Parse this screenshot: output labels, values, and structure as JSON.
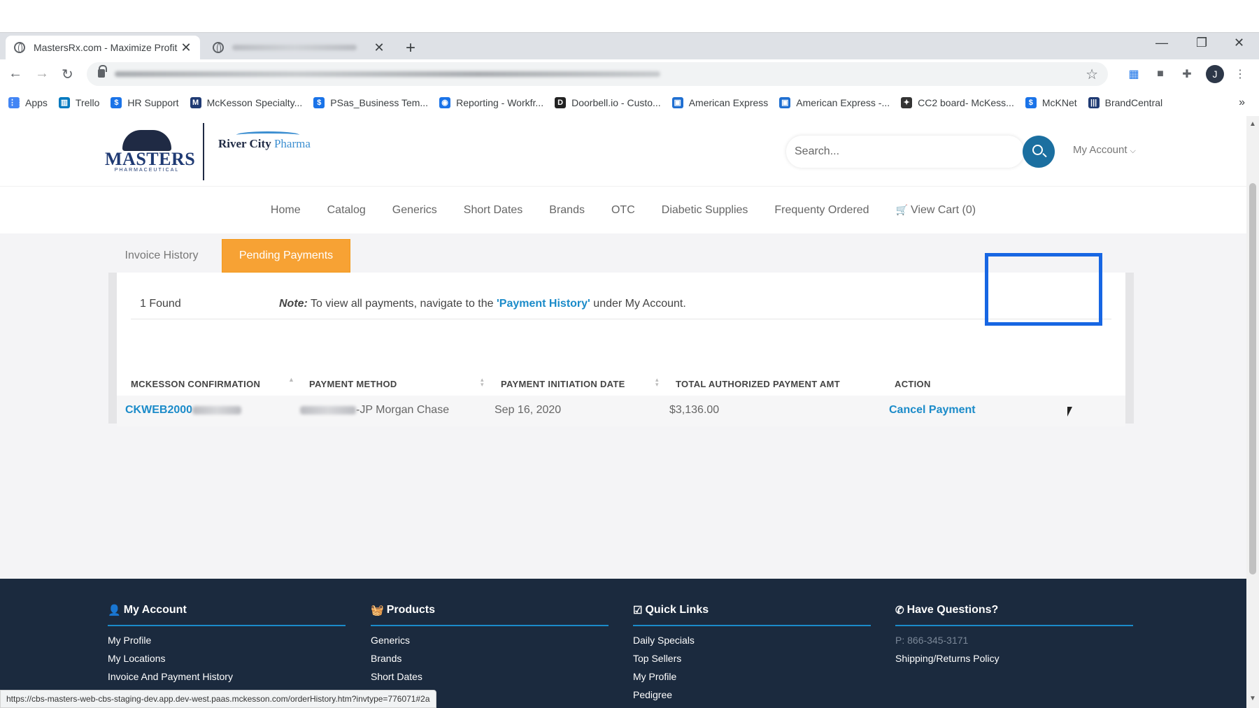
{
  "browser": {
    "tabs": [
      {
        "title": "MastersRx.com - Maximize Profit",
        "active": true
      },
      {
        "title": "",
        "active": false
      }
    ],
    "bookmarks": [
      {
        "label": "Apps",
        "icon": "apps-grid-icon",
        "color": "#4285f4"
      },
      {
        "label": "Trello",
        "icon": "trello-icon",
        "color": "#0079bf"
      },
      {
        "label": "HR Support",
        "icon": "hr-support-icon",
        "color": "#1a73e8"
      },
      {
        "label": "McKesson Specialty...",
        "icon": "mckesson-icon",
        "color": "#1f3a73"
      },
      {
        "label": "PSas_Business Tem...",
        "icon": "psas-icon",
        "color": "#1a73e8"
      },
      {
        "label": "Reporting - Workfr...",
        "icon": "reporting-icon",
        "color": "#1a73e8"
      },
      {
        "label": "Doorbell.io - Custo...",
        "icon": "doorbell-icon",
        "color": "#222222"
      },
      {
        "label": "American Express",
        "icon": "amex-icon",
        "color": "#1f6fd1"
      },
      {
        "label": "American Express -...",
        "icon": "amex-icon",
        "color": "#1f6fd1"
      },
      {
        "label": "CC2 board- McKess...",
        "icon": "cc2-icon",
        "color": "#333333"
      },
      {
        "label": "McKNet",
        "icon": "mcknet-icon",
        "color": "#1a73e8"
      },
      {
        "label": "BrandCentral",
        "icon": "brandcentral-icon",
        "color": "#1f3a73"
      }
    ],
    "more_bookmarks": "»",
    "profile_initial": "J",
    "status_url": "https://cbs-masters-web-cbs-staging-dev.app.dev-west.paas.mckesson.com/orderHistory.htm?invtype=776071#2a"
  },
  "header": {
    "logo_masters": "MASTERS",
    "logo_masters_sub": "PHARMACEUTICAL",
    "logo_rc_name": "River City",
    "logo_rc_pharma": "Pharma",
    "search_placeholder": "Search...",
    "my_account": "My Account"
  },
  "nav": [
    "Home",
    "Catalog",
    "Generics",
    "Short Dates",
    "Brands",
    "OTC",
    "Diabetic Supplies",
    "Frequenty Ordered",
    "View Cart (0)"
  ],
  "tabs": {
    "invoice_history": "Invoice History",
    "pending_payments": "Pending Payments"
  },
  "results": {
    "count_text": "1 Found",
    "note_label": "Note:",
    "note_text_1": " To view all payments, navigate to the ",
    "note_link": "'Payment History'",
    "note_text_2": " under My Account."
  },
  "table": {
    "headers": [
      "MCKESSON CONFIRMATION",
      "PAYMENT METHOD",
      "PAYMENT INITIATION DATE",
      "TOTAL AUTHORIZED PAYMENT AMT",
      "ACTION"
    ],
    "rows": [
      {
        "confirmation": "CKWEB2000",
        "method": "-JP Morgan Chase",
        "date": "Sep 16, 2020",
        "amount": "$3,136.00",
        "action": "Cancel Payment"
      }
    ]
  },
  "footer": {
    "my_account": {
      "title": "My Account",
      "links": [
        "My Profile",
        "My Locations",
        "Invoice And Payment History"
      ]
    },
    "products": {
      "title": "Products",
      "links": [
        "Generics",
        "Brands",
        "Short Dates"
      ]
    },
    "quick_links": {
      "title": "Quick Links",
      "links": [
        "Daily Specials",
        "Top Sellers",
        "My Profile",
        "Pedigree"
      ]
    },
    "questions": {
      "title": "Have Questions?",
      "phone": "P: 866-345-3171",
      "links": [
        "Shipping/Returns Policy"
      ]
    }
  },
  "colors": {
    "accent_orange": "#f7a234",
    "link_blue": "#1b8bc9",
    "footer_bg": "#1b2a3e",
    "highlight": "#1766e3"
  }
}
